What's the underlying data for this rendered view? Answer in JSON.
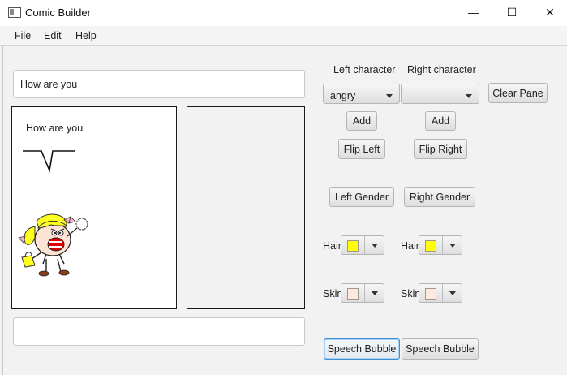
{
  "window": {
    "title": "Comic Builder",
    "controls": {
      "minimize": "—",
      "maximize": "☐",
      "close": "✕"
    }
  },
  "menu": {
    "items": [
      "File",
      "Edit",
      "Help"
    ]
  },
  "top_field": {
    "value": "How are you"
  },
  "bottom_field": {
    "value": ""
  },
  "left_panel": {
    "caption": "How are you"
  },
  "controls": {
    "left_character_label": "Left character",
    "right_character_label": "Right character",
    "left_combo_value": "angry",
    "right_combo_value": "",
    "clear_pane": "Clear Pane",
    "add_left": "Add",
    "add_right": "Add",
    "flip_left": "Flip Left",
    "flip_right": "Flip Right",
    "left_gender": "Left Gender",
    "right_gender": "Right Gender",
    "hair_label_left": "Hair",
    "hair_label_right": "Hair",
    "skin_label_left": "Skin",
    "skin_label_right": "Skin",
    "speech_bubble_left": "Speech Bubble",
    "speech_bubble_right": "Speech Bubble"
  },
  "colors": {
    "hair_left": "#ffff00",
    "hair_right": "#ffff00",
    "skin_left": "#fde9de",
    "skin_right": "#fde9de",
    "focus_border": "#3b8fd6"
  }
}
